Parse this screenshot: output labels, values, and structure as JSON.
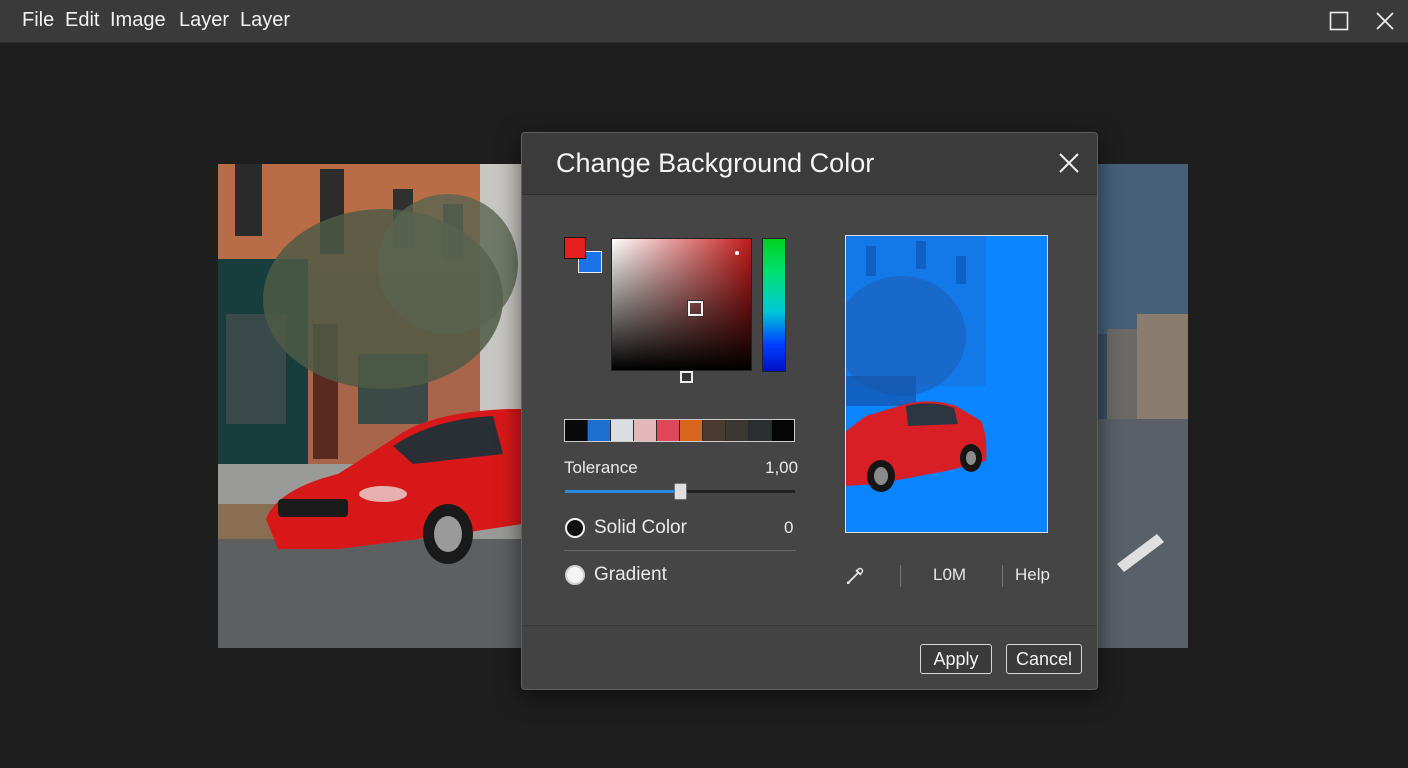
{
  "menu": {
    "file": "File",
    "edit": "Edit",
    "image": "Image",
    "layer1": "Layer",
    "layer2": "Layer"
  },
  "window_controls": {
    "maximize_icon": "square-outline-icon",
    "close_icon": "close-icon"
  },
  "dialog": {
    "title": "Change Background Color",
    "close_icon": "close-icon",
    "foreground_color": "#e62020",
    "background_color": "#1a73e8",
    "palette": [
      "#0a0a0a",
      "#1f6fd1",
      "#dadde2",
      "#e4b7bd",
      "#e0485a",
      "#d8661c",
      "#4a3a30",
      "#3b3834",
      "#2a2e2e",
      "#050505"
    ],
    "tolerance_label": "Tolerance",
    "tolerance_value": "1,00",
    "tolerance_fraction": 0.5,
    "solid_color_label": "Solid Color",
    "solid_color_value": "0",
    "gradient_label": "Gradient",
    "solid_color_selected": true,
    "eyedropper_icon": "eyedropper-icon",
    "lom_label": "L0M",
    "help_label": "Help",
    "preview_color": "#0a84ff",
    "apply_label": "Apply",
    "cancel_label": "Cancel"
  }
}
